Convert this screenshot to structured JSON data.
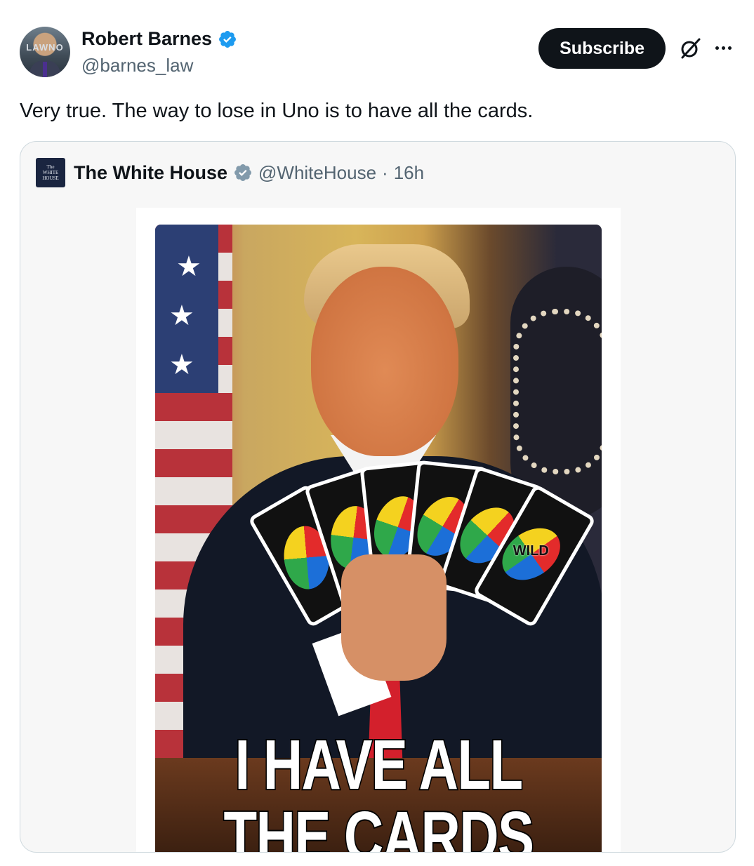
{
  "post": {
    "author": {
      "name": "Robert Barnes",
      "handle": "@barnes_law",
      "avatar_logo_text": "LAWNO"
    },
    "subscribe_label": "Subscribe",
    "text": "Very true. The way to lose in Uno is to have all the cards.",
    "icons": [
      "verified-badge-icon",
      "grok-icon",
      "more-options-icon"
    ]
  },
  "quote": {
    "name": "The White House",
    "handle": "@WhiteHouse",
    "separator": "·",
    "time": "16h",
    "avatar_text": [
      "The",
      "WHITE",
      "HOUSE"
    ],
    "media": {
      "card_label": "WILD",
      "caption_line_1": "I HAVE ALL",
      "caption_line_2": "THE CARDS"
    }
  },
  "colors": {
    "verified_blue": "#1d9bf0",
    "gov_verified_gray": "#829aab",
    "subscribe_bg": "#0f1419",
    "secondary_text": "#536471"
  }
}
